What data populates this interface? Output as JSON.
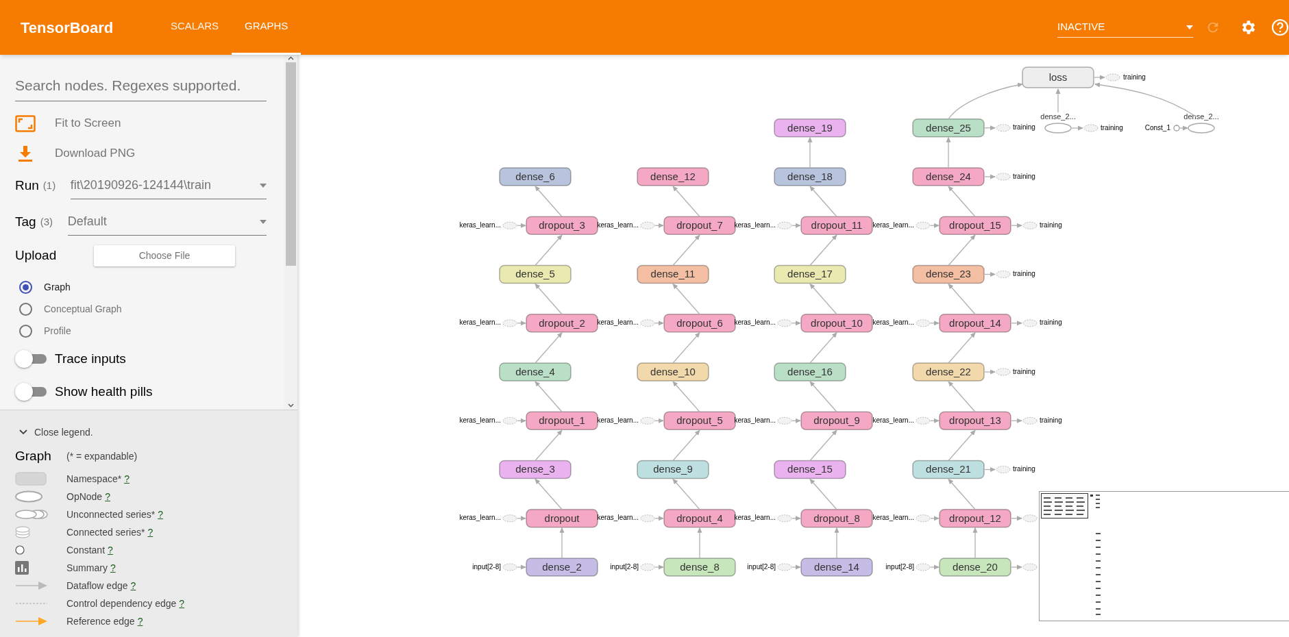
{
  "header": {
    "title": "TensorBoard",
    "tabs": [
      {
        "label": "SCALARS",
        "selected": false
      },
      {
        "label": "GRAPHS",
        "selected": true
      }
    ],
    "run_select": {
      "value": "INACTIVE"
    }
  },
  "sidebar": {
    "search": {
      "placeholder": "Search nodes. Regexes supported."
    },
    "actions": [
      {
        "kind": "fit",
        "label": "Fit to Screen"
      },
      {
        "kind": "download",
        "label": "Download PNG"
      }
    ],
    "run": {
      "label": "Run",
      "count": "(1)",
      "value": "fit\\20190926-124144\\train"
    },
    "tag": {
      "label": "Tag",
      "count": "(3)",
      "value": "Default"
    },
    "upload": {
      "label": "Upload",
      "button": "Choose File"
    },
    "modes": [
      {
        "label": "Graph",
        "selected": true
      },
      {
        "label": "Conceptual Graph",
        "selected": false
      },
      {
        "label": "Profile",
        "selected": false
      }
    ],
    "toggles": [
      {
        "label": "Trace inputs",
        "on": false
      },
      {
        "label": "Show health pills",
        "on": false
      }
    ]
  },
  "legend": {
    "toggle": "Close legend.",
    "title": "Graph",
    "note": "(* = expandable)",
    "items": [
      {
        "kind": "namespace",
        "label": "Namespace*",
        "help": "?"
      },
      {
        "kind": "opnode",
        "label": "OpNode",
        "help": "?"
      },
      {
        "kind": "unconnected",
        "label": "Unconnected series*",
        "help": "?"
      },
      {
        "kind": "connected",
        "label": "Connected series*",
        "help": "?"
      },
      {
        "kind": "constant",
        "label": "Constant",
        "help": "?"
      },
      {
        "kind": "summary",
        "label": "Summary",
        "help": "?"
      },
      {
        "kind": "dataflow",
        "label": "Dataflow edge",
        "help": "?"
      },
      {
        "kind": "control",
        "label": "Control dependency edge",
        "help": "?"
      },
      {
        "kind": "reference",
        "label": "Reference edge",
        "help": "?"
      }
    ]
  },
  "graph": {
    "columns": [
      {
        "nodes": [
          {
            "name": "dense_6",
            "color": "#b8c3dd"
          },
          {
            "name": "dropout_3",
            "color": "#f5a8c3",
            "input": "keras_learn..."
          },
          {
            "name": "dense_5",
            "color": "#eaeab0"
          },
          {
            "name": "dropout_2",
            "color": "#f5a8c3",
            "input": "keras_learn..."
          },
          {
            "name": "dense_4",
            "color": "#b9dfc6"
          },
          {
            "name": "dropout_1",
            "color": "#f5a8c3",
            "input": "keras_learn..."
          },
          {
            "name": "dense_3",
            "color": "#eab2ee"
          },
          {
            "name": "dropout",
            "color": "#f5a8c3",
            "input": "keras_learn..."
          },
          {
            "name": "dense_2",
            "color": "#c6bde6",
            "input": "input[2-8]"
          }
        ]
      },
      {
        "nodes": [
          {
            "name": "dense_12",
            "color": "#f5a8c3"
          },
          {
            "name": "dropout_7",
            "color": "#f5a8c3",
            "input": "keras_learn..."
          },
          {
            "name": "dense_11",
            "color": "#f4bea2"
          },
          {
            "name": "dropout_6",
            "color": "#f5a8c3",
            "input": "keras_learn..."
          },
          {
            "name": "dense_10",
            "color": "#f1d9ab"
          },
          {
            "name": "dropout_5",
            "color": "#f5a8c3",
            "input": "keras_learn..."
          },
          {
            "name": "dense_9",
            "color": "#bfe0e0"
          },
          {
            "name": "dropout_4",
            "color": "#f5a8c3",
            "input": "keras_learn..."
          },
          {
            "name": "dense_8",
            "color": "#c8e6bc",
            "input": "input[2-8]"
          }
        ]
      },
      {
        "nodes": [
          {
            "name": "dense_19",
            "color": "#eab2ee"
          },
          {
            "name": "dense_18",
            "color": "#b8c3dd"
          },
          {
            "name": "dropout_11",
            "color": "#f5a8c3",
            "input": "keras_learn..."
          },
          {
            "name": "dense_17",
            "color": "#eaeab0"
          },
          {
            "name": "dropout_10",
            "color": "#f5a8c3",
            "input": "keras_learn..."
          },
          {
            "name": "dense_16",
            "color": "#b9dfc6"
          },
          {
            "name": "dropout_9",
            "color": "#f5a8c3",
            "input": "keras_learn..."
          },
          {
            "name": "dense_15",
            "color": "#eab2ee"
          },
          {
            "name": "dropout_8",
            "color": "#f5a8c3",
            "input": "keras_learn..."
          },
          {
            "name": "dense_14",
            "color": "#c6bde6",
            "input": "input[2-8]"
          }
        ]
      },
      {
        "nodes": [
          {
            "name": "dense_25",
            "color": "#b9dfc6",
            "output": "training"
          },
          {
            "name": "dense_24",
            "color": "#f5a8c3",
            "output": "training"
          },
          {
            "name": "dropout_15",
            "color": "#f5a8c3",
            "input": "keras_learn...",
            "output": "training"
          },
          {
            "name": "dense_23",
            "color": "#f4bea2",
            "output": "training"
          },
          {
            "name": "dropout_14",
            "color": "#f5a8c3",
            "input": "keras_learn...",
            "output": "training"
          },
          {
            "name": "dense_22",
            "color": "#f1d9ab",
            "output": "training"
          },
          {
            "name": "dropout_13",
            "color": "#f5a8c3",
            "input": "keras_learn...",
            "output": "training"
          },
          {
            "name": "dense_21",
            "color": "#bfe0e0",
            "output": "training"
          },
          {
            "name": "dropout_12",
            "color": "#f5a8c3",
            "input": "keras_learn...",
            "output_stub": true
          },
          {
            "name": "dense_20",
            "color": "#c8e6bc",
            "input": "input[2-8]",
            "output_stub": true
          }
        ]
      }
    ],
    "loss": {
      "name": "loss",
      "color": "#eeeeee",
      "output": "training"
    },
    "ops": [
      {
        "name": "dense_2...",
        "output": "training"
      },
      {
        "name": "dense_2...",
        "input": "Const_1"
      }
    ]
  }
}
